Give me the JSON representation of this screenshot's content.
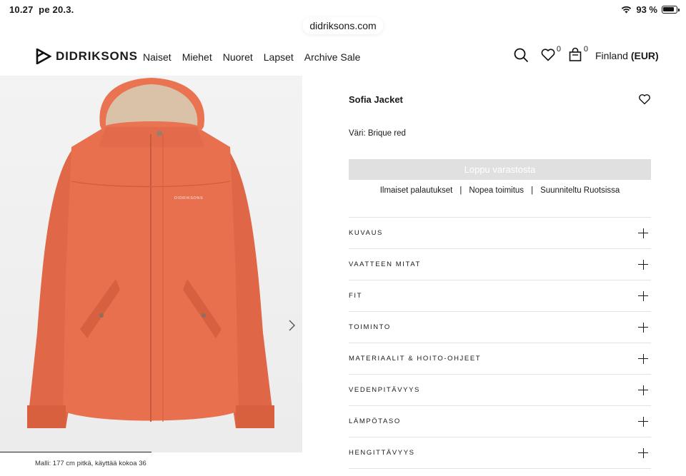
{
  "status": {
    "time": "10.27",
    "date": "pe 20.3.",
    "battery": "93 %"
  },
  "browser": {
    "url": "didriksons.com"
  },
  "header": {
    "logo": "DIDRIKSONS",
    "nav": [
      "Naiset",
      "Miehet",
      "Nuoret",
      "Lapset",
      "Archive Sale"
    ],
    "wishlist_count": "0",
    "cart_count": "0",
    "region": "Finland",
    "currency": "(EUR)"
  },
  "image": {
    "alt_brand": "DIDRIKSONS",
    "caption": "Malli: 177 cm pitkä, käyttää kokoa 36"
  },
  "product": {
    "name": "Sofia Jacket",
    "color_label": "Väri: Brique red",
    "button": "Loppu varastosta",
    "usps": [
      "Ilmaiset palautukset",
      "Nopea toimitus",
      "Suunniteltu Ruotsissa"
    ],
    "usp_separator": "|",
    "sections": [
      "KUVAUS",
      "VAATTEEN MITAT",
      "FIT",
      "TOIMINTO",
      "MATERIAALIT & HOITO-OHJEET",
      "VEDENPITÄVYYS",
      "LÄMPÖTASO",
      "HENGITTÄVYYS"
    ]
  },
  "colors": {
    "jacket": "#e8704f",
    "lining": "#d9c2a8",
    "button_disabled": "#e0e0e0"
  }
}
